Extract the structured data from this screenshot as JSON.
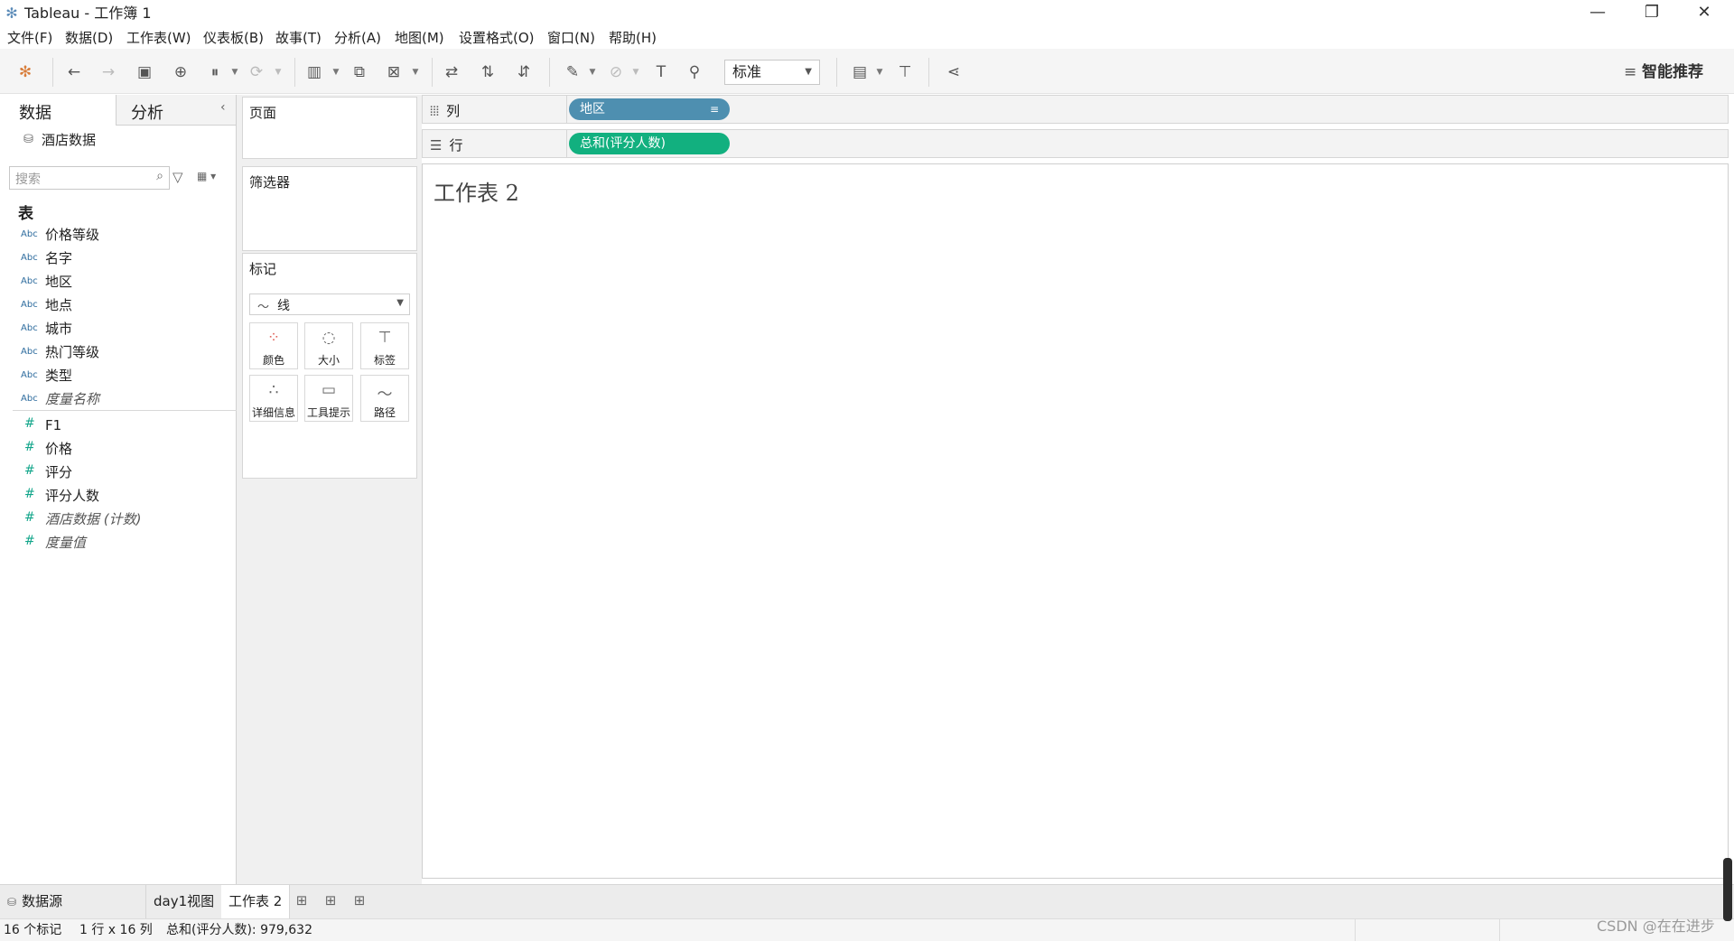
{
  "window": {
    "title": "Tableau - 工作簿 1",
    "minimize": "—",
    "maximize": "❐",
    "close": "✕"
  },
  "menu": [
    "文件(F)",
    "数据(D)",
    "工作表(W)",
    "仪表板(B)",
    "故事(T)",
    "分析(A)",
    "地图(M)",
    "设置格式(O)",
    "窗口(N)",
    "帮助(H)"
  ],
  "toolbar": {
    "fit_mode": "标准",
    "smart_recommend": "智能推荐"
  },
  "data_pane": {
    "tab_data": "数据",
    "tab_analysis": "分析",
    "datasource": "酒店数据",
    "search_placeholder": "搜索",
    "section_tables": "表",
    "dimensions": [
      {
        "type": "Abc",
        "name": "价格等级"
      },
      {
        "type": "Abc",
        "name": "名字"
      },
      {
        "type": "Abc",
        "name": "地区"
      },
      {
        "type": "Abc",
        "name": "地点"
      },
      {
        "type": "Abc",
        "name": "城市"
      },
      {
        "type": "Abc",
        "name": "热门等级"
      },
      {
        "type": "Abc",
        "name": "类型"
      },
      {
        "type": "Abc",
        "name": "度量名称"
      }
    ],
    "measures": [
      {
        "type": "#",
        "name": "F1"
      },
      {
        "type": "#",
        "name": "价格"
      },
      {
        "type": "#",
        "name": "评分"
      },
      {
        "type": "#",
        "name": "评分人数"
      },
      {
        "type": "#",
        "name": "酒店数据 (计数)"
      },
      {
        "type": "#",
        "name": "度量值"
      }
    ]
  },
  "cards": {
    "pages": "页面",
    "filters": "筛选器",
    "marks": "标记",
    "mark_type": "线",
    "mark_buttons": [
      "颜色",
      "大小",
      "标签",
      "详细信息",
      "工具提示",
      "路径"
    ]
  },
  "shelves": {
    "columns_label": "列",
    "rows_label": "行",
    "columns_pill": "地区",
    "rows_pill": "总和(评分人数)",
    "columns_pill_color": "#4e8fb0",
    "rows_pill_color": "#12b07f"
  },
  "view": {
    "sheet_title": "工作表 2"
  },
  "bottom_tabs": {
    "datasource": "数据源",
    "sheets": [
      "day1视图",
      "工作表 2"
    ],
    "active": "工作表 2"
  },
  "status": {
    "marks": "16 个标记",
    "dims": "1 行 x 16 列",
    "sum": "总和(评分人数): 979,632"
  },
  "watermark": "CSDN @在在进步"
}
